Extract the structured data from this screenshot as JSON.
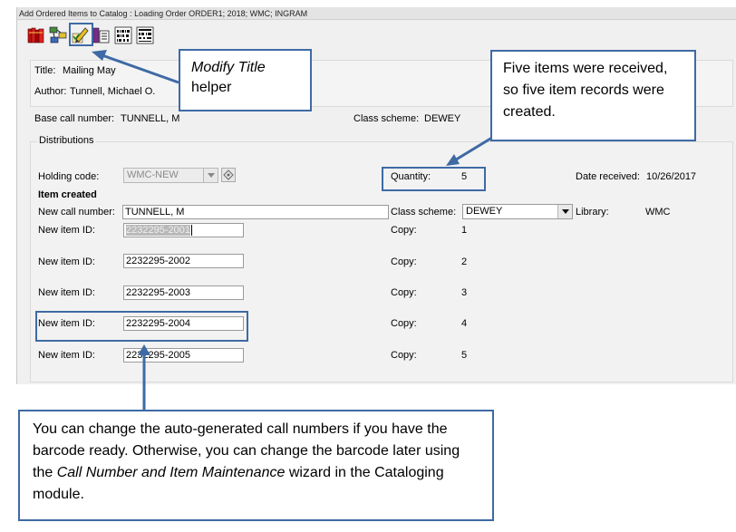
{
  "window": {
    "title": "Add Ordered Items to Catalog : Loading Order  ORDER1; 2018; WMC; INGRAM"
  },
  "toolbar": {
    "buttons": [
      {
        "name": "books-icon"
      },
      {
        "name": "network-icon"
      },
      {
        "name": "modify-title-icon"
      },
      {
        "name": "holdings-icon"
      },
      {
        "name": "barcode-icon"
      },
      {
        "name": "barcode-list-icon"
      }
    ]
  },
  "title_info": {
    "title_label": "Title:",
    "title_value": "Mailing May",
    "author_label": "Author:",
    "author_value": "Tunnell, Michael O."
  },
  "base": {
    "call_label": "Base call number:",
    "call_value": "TUNNELL, M",
    "class_label": "Class scheme:",
    "class_value": "DEWEY"
  },
  "distributions": {
    "heading": "Distributions",
    "holding_label": "Holding code:",
    "holding_value": "WMC-NEW",
    "quantity_label": "Quantity:",
    "quantity_value": "5",
    "date_label": "Date received:",
    "date_value": "10/26/2017",
    "item_created": "Item created",
    "new_call_label": "New call number:",
    "new_call_value": "TUNNELL, M",
    "class_label": "Class scheme:",
    "class_value": "DEWEY",
    "library_label": "Library:",
    "library_value": "WMC",
    "items": [
      {
        "id_label": "New item ID:",
        "id_value": "2232295-2001",
        "copy_label": "Copy:",
        "copy_value": "1"
      },
      {
        "id_label": "New item ID:",
        "id_value": "2232295-2002",
        "copy_label": "Copy:",
        "copy_value": "2"
      },
      {
        "id_label": "New item ID:",
        "id_value": "2232295-2003",
        "copy_label": "Copy:",
        "copy_value": "3"
      },
      {
        "id_label": "New item ID:",
        "id_value": "2232295-2004",
        "copy_label": "Copy:",
        "copy_value": "4"
      },
      {
        "id_label": "New item ID:",
        "id_value": "2232295-2005",
        "copy_label": "Copy:",
        "copy_value": "5"
      }
    ]
  },
  "callouts": {
    "modify_title_italic": "Modify Title",
    "modify_title_rest": "helper",
    "quantity_note": "Five items were received, so five item records were created.",
    "bottom_part1": "You can change the auto-generated call numbers if you have the barcode ready. Otherwise, you can change the barcode later using the ",
    "bottom_italic": "Call Number and Item Maintenance",
    "bottom_part2": " wizard in the Cataloging module."
  },
  "colors": {
    "accent": "#3e6aa5"
  }
}
